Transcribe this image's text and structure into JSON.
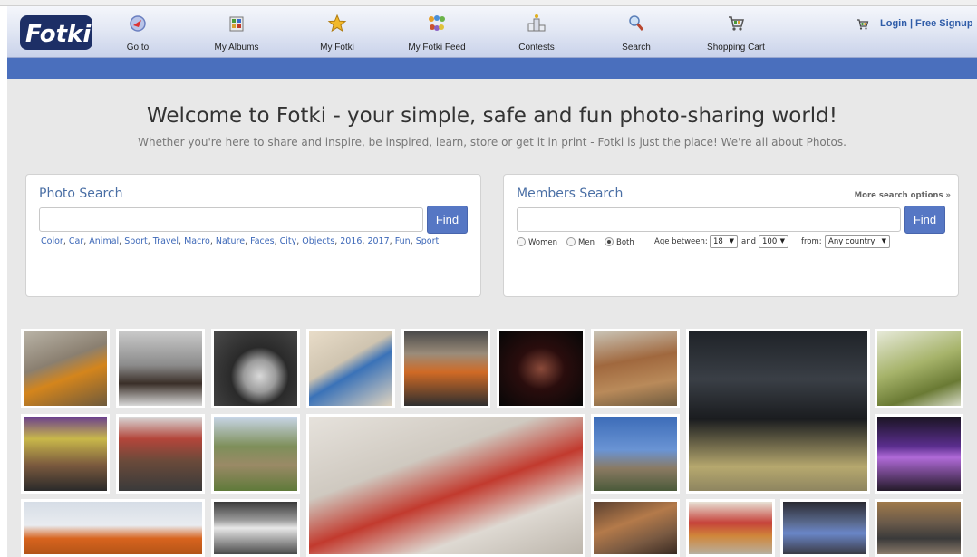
{
  "header": {
    "logo_text": "Fotki",
    "nav": [
      {
        "label": "Go to",
        "icon": "goto-icon"
      },
      {
        "label": "My Albums",
        "icon": "albums-icon"
      },
      {
        "label": "My Fotki",
        "icon": "star-icon"
      },
      {
        "label": "My Fotki Feed",
        "icon": "feed-icon"
      },
      {
        "label": "Contests",
        "icon": "podium-icon"
      },
      {
        "label": "Search",
        "icon": "search-icon"
      },
      {
        "label": "Shopping Cart",
        "icon": "cart-icon"
      }
    ],
    "login_label": "Login",
    "separator": "|",
    "signup_label": "Free Signup"
  },
  "welcome": {
    "title": "Welcome to Fotki - your simple, safe and fun photo-sharing world!",
    "subtitle": "Whether you're here to share and inspire, be inspired, learn, store or get it in print - Fotki is just the place! We're all about Photos."
  },
  "photo_search": {
    "title": "Photo Search",
    "input_value": "",
    "find_label": "Find",
    "tags": [
      "Color",
      "Car",
      "Animal",
      "Sport",
      "Travel",
      "Macro",
      "Nature",
      "Faces",
      "City",
      "Objects",
      "2016",
      "2017",
      "Fun",
      "Sport"
    ]
  },
  "members_search": {
    "title": "Members Search",
    "more_options": "More search options »",
    "input_value": "",
    "find_label": "Find",
    "gender_options": [
      {
        "label": "Women",
        "selected": false
      },
      {
        "label": "Men",
        "selected": false
      },
      {
        "label": "Both",
        "selected": true
      }
    ],
    "age_label": "Age between:",
    "age_min": "18",
    "age_and": "and",
    "age_max": "100",
    "from_label": "from:",
    "country": "Any country"
  },
  "colors": {
    "accent_blue": "#4a6fbd",
    "find_button": "#5677c4",
    "link": "#3d68b8"
  },
  "photos": [
    {
      "name": "photo-orange-car-model"
    },
    {
      "name": "photo-vintage-motorcycle"
    },
    {
      "name": "photo-car-wheel"
    },
    {
      "name": "photo-vinyl-record"
    },
    {
      "name": "photo-orange-toy-car"
    },
    {
      "name": "photo-stage-performers"
    },
    {
      "name": "photo-autumn-branches"
    },
    {
      "name": "photo-black-pickup-truck"
    },
    {
      "name": "photo-green-vines"
    },
    {
      "name": "photo-magazine-cover"
    },
    {
      "name": "photo-street-cafe"
    },
    {
      "name": "photo-country-path"
    },
    {
      "name": "photo-stacked-boxes"
    },
    {
      "name": "photo-winter-trees"
    },
    {
      "name": "photo-singer-stage"
    },
    {
      "name": "photo-tow-truck"
    },
    {
      "name": "photo-stormtrooper"
    },
    {
      "name": "photo-woman-portrait"
    },
    {
      "name": "photo-toy-car-shelf"
    },
    {
      "name": "photo-blue-classic-car"
    },
    {
      "name": "photo-street-night"
    }
  ]
}
